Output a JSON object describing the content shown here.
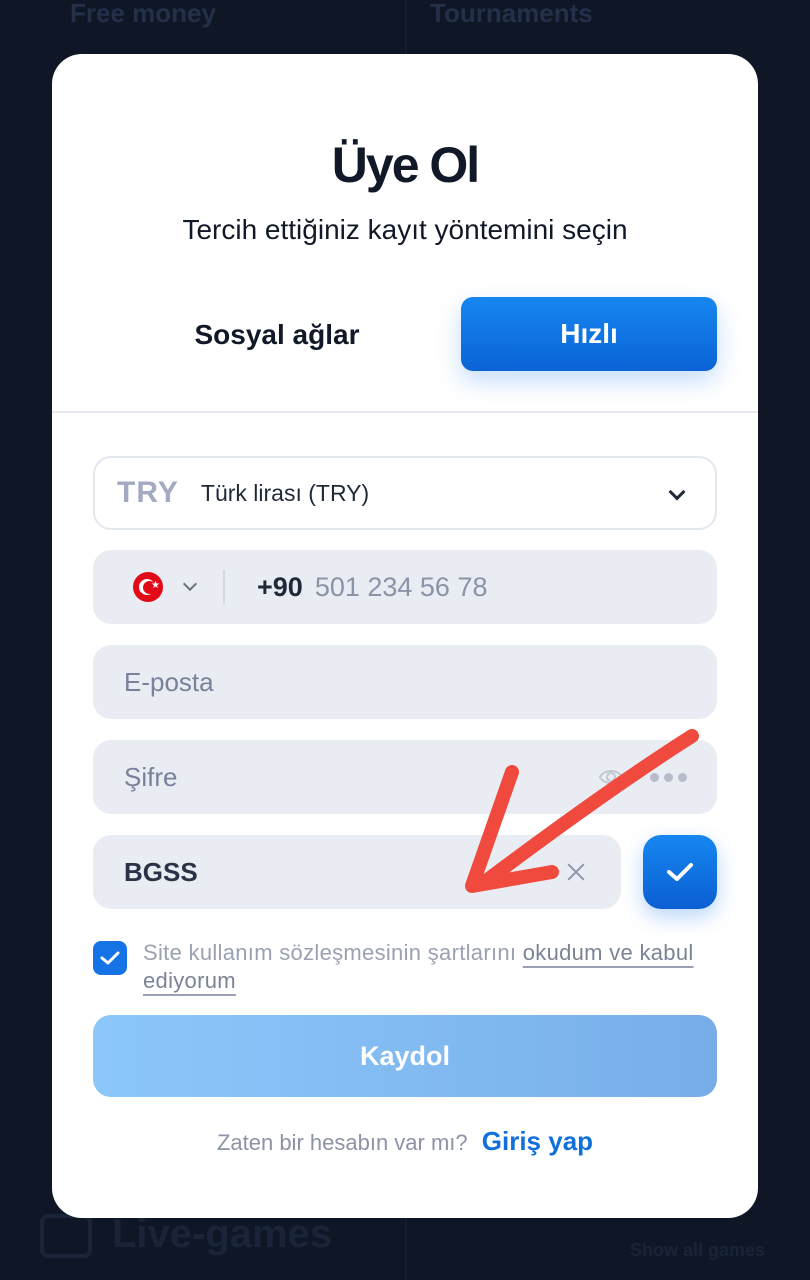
{
  "background": {
    "top_left_text": "Free money",
    "top_right_text": "Tournaments",
    "bottom_text": "Live-games",
    "bottom_right_text": "Show all games"
  },
  "modal": {
    "title": "Üye Ol",
    "subtitle": "Tercih ettiğiniz kayıt yöntemini seçin",
    "tabs": {
      "social_label": "Sosyal ağlar",
      "quick_label": "Hızlı",
      "active": "quick"
    },
    "currency": {
      "code": "TRY",
      "name": "Türk lirası (TRY)"
    },
    "phone": {
      "country_code": "+90",
      "placeholder": "501 234 56 78",
      "flag": "turkey-flag"
    },
    "email": {
      "placeholder": "E-posta"
    },
    "password": {
      "placeholder": "Şifre"
    },
    "promo": {
      "value": "BGSS"
    },
    "terms": {
      "checked": true,
      "text": "Site kullanım sözleşmesinin şartlarını ",
      "link_text": "okudum ve kabul ediyorum"
    },
    "submit_label": "Kaydol",
    "login": {
      "question": "Zaten bir hesabın var mı?",
      "link_label": "Giriş yap"
    }
  },
  "colors": {
    "accent": "#0b63d6",
    "page_background": "#0f1726",
    "field_background": "#e9edf3",
    "annotation_arrow": "#f04a3e"
  }
}
